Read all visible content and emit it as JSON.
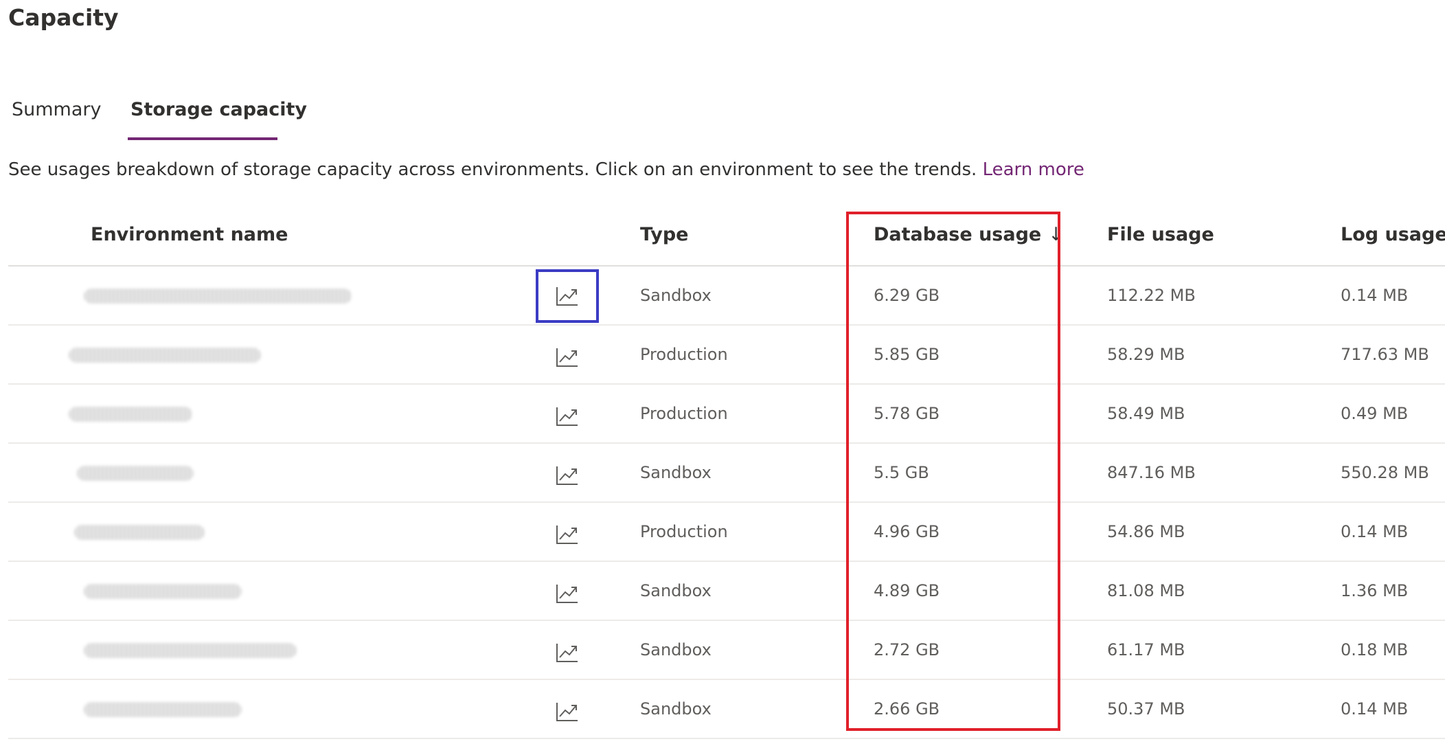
{
  "page": {
    "title": "Capacity"
  },
  "tabs": [
    {
      "label": "Summary"
    },
    {
      "label": "Storage capacity"
    }
  ],
  "description": {
    "text": "See usages breakdown of storage capacity across environments. Click on an environment to see the trends. ",
    "link": "Learn more"
  },
  "table": {
    "headers": {
      "name": "Environment name",
      "type": "Type",
      "database": "Database usage",
      "database_sort": "↓",
      "file": "File usage",
      "log": "Log usage"
    },
    "rows": [
      {
        "type": "Sandbox",
        "database": "6.29 GB",
        "file": "112.22 MB",
        "log": "0.14 MB"
      },
      {
        "type": "Production",
        "database": "5.85 GB",
        "file": "58.29 MB",
        "log": "717.63 MB"
      },
      {
        "type": "Production",
        "database": "5.78 GB",
        "file": "58.49 MB",
        "log": "0.49 MB"
      },
      {
        "type": "Sandbox",
        "database": "5.5 GB",
        "file": "847.16 MB",
        "log": "550.28 MB"
      },
      {
        "type": "Production",
        "database": "4.96 GB",
        "file": "54.86 MB",
        "log": "0.14 MB"
      },
      {
        "type": "Sandbox",
        "database": "4.89 GB",
        "file": "81.08 MB",
        "log": "1.36 MB"
      },
      {
        "type": "Sandbox",
        "database": "2.72 GB",
        "file": "61.17 MB",
        "log": "0.18 MB"
      },
      {
        "type": "Sandbox",
        "database": "2.66 GB",
        "file": "50.37 MB",
        "log": "0.14 MB"
      }
    ]
  },
  "icons": {
    "trend": "trend-chart-icon"
  },
  "colors": {
    "accent": "#742774",
    "highlight_red": "#e0202a",
    "focus_blue": "#3b3bc4"
  }
}
